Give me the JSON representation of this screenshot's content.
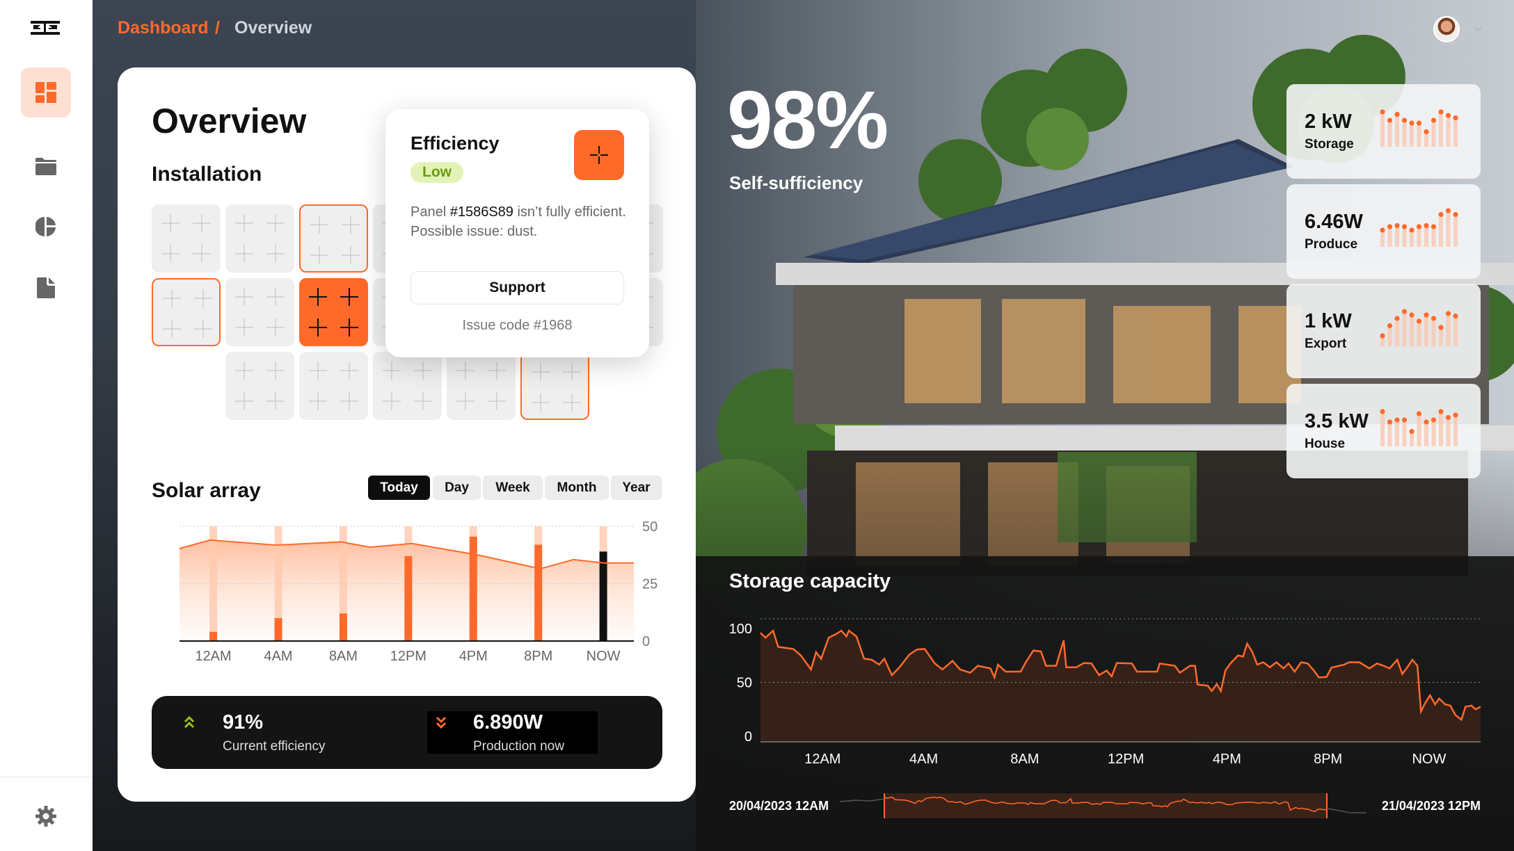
{
  "breadcrumb": {
    "root": "Dashboard",
    "separator": "/",
    "current": "Overview"
  },
  "sidebar": {
    "items": [
      {
        "name": "dashboard",
        "active": true
      },
      {
        "name": "folder"
      },
      {
        "name": "pie-chart"
      },
      {
        "name": "document"
      }
    ],
    "settings": "gear"
  },
  "overview": {
    "title": "Overview",
    "installation_title": "Installation",
    "tiles": [
      {
        "row": 0,
        "col": 0,
        "state": "normal"
      },
      {
        "row": 0,
        "col": 1,
        "state": "normal"
      },
      {
        "row": 0,
        "col": 2,
        "state": "outlined"
      },
      {
        "row": 0,
        "col": 3,
        "state": "normal"
      },
      {
        "row": 0,
        "col": 4,
        "state": "normal"
      },
      {
        "row": 0,
        "col": 5,
        "state": "normal"
      },
      {
        "row": 0,
        "col": 6,
        "state": "normal"
      },
      {
        "row": 1,
        "col": 0,
        "state": "outlined"
      },
      {
        "row": 1,
        "col": 1,
        "state": "normal"
      },
      {
        "row": 1,
        "col": 2,
        "state": "active"
      },
      {
        "row": 1,
        "col": 3,
        "state": "normal"
      },
      {
        "row": 1,
        "col": 4,
        "state": "normal"
      },
      {
        "row": 1,
        "col": 5,
        "state": "normal"
      },
      {
        "row": 1,
        "col": 6,
        "state": "normal"
      },
      {
        "row": 2,
        "col": 1,
        "state": "normal"
      },
      {
        "row": 2,
        "col": 2,
        "state": "normal"
      },
      {
        "row": 2,
        "col": 3,
        "state": "normal"
      },
      {
        "row": 2,
        "col": 4,
        "state": "normal"
      },
      {
        "row": 2,
        "col": 5,
        "state": "outlined"
      }
    ]
  },
  "popup": {
    "title": "Efficiency",
    "badge": "Low",
    "text_prefix": "Panel ",
    "panel_id": "#1586S89",
    "text_suffix": " isn’t fully efficient. Possible issue: dust.",
    "button": "Support",
    "issue_code": "Issue code #1968"
  },
  "solar": {
    "title": "Solar array",
    "tabs": [
      "Today",
      "Day",
      "Week",
      "Month",
      "Year"
    ],
    "active_tab": "Today"
  },
  "stats": {
    "efficiency_value": "91%",
    "efficiency_label": "Current efficiency",
    "production_value": "6.890W",
    "production_label": "Production now"
  },
  "hero": {
    "value": "98%",
    "label": "Self-sufficiency"
  },
  "metrics": [
    {
      "value": "2 kW",
      "label": "Storage",
      "spark": [
        10,
        7.6,
        9.3,
        7.6,
        6.8,
        6.8,
        4.3,
        7.6,
        10,
        9,
        8.3
      ]
    },
    {
      "value": "6.46W",
      "label": "Produce",
      "spark": [
        4.8,
        5.8,
        6.1,
        5.8,
        4.8,
        5.8,
        6.1,
        5.8,
        9.3,
        10.4,
        9.3
      ]
    },
    {
      "value": "1 kW",
      "label": "Export",
      "spark": [
        3,
        5.9,
        8,
        10,
        9,
        7.2,
        9,
        8,
        5.4,
        9.4,
        8.7
      ]
    },
    {
      "value": "3.5 kW",
      "label": "House",
      "spark": [
        10,
        7,
        7.6,
        7.6,
        4.3,
        9.4,
        7,
        7.6,
        10,
        8.3,
        9
      ]
    }
  ],
  "storage": {
    "title": "Storage capacity",
    "range_start": "20/04/2023 12AM",
    "range_end": "21/04/2023 12PM"
  },
  "colors": {
    "accent": "#ff6a2b",
    "accent_light": "#fde0d2",
    "badge_bg": "#e3f3b8",
    "badge_text": "#6d9a12",
    "dark": "#141414"
  },
  "chart_data": [
    {
      "type": "bar",
      "categories": [
        "12AM",
        "4AM",
        "8AM",
        "12PM",
        "4PM",
        "8PM",
        "NOW"
      ],
      "series": [
        {
          "values": [
            4,
            10,
            12,
            37,
            45.5,
            42,
            39
          ]
        },
        {
          "values": [
            50,
            50,
            50,
            50,
            50,
            50,
            50
          ]
        }
      ],
      "highlight": "NOW",
      "line": {
        "x": [
          -0.52,
          -0.05,
          0.98,
          1.97,
          2.41,
          3.06,
          4.07,
          5.03,
          5.54,
          6.01,
          6.47
        ],
        "y": [
          40.3,
          44,
          41.8,
          43.2,
          40.9,
          42.5,
          37.5,
          31.5,
          35.5,
          34,
          34
        ]
      },
      "yticks": [
        0,
        25,
        50
      ],
      "ylim": [
        0,
        50
      ],
      "grid": true
    },
    {
      "type": "area",
      "xticks": [
        "12AM",
        "4AM",
        "8AM",
        "12PM",
        "4PM",
        "8PM",
        "NOW"
      ],
      "xtick_hours": [
        0,
        4,
        8,
        12,
        16,
        20,
        24
      ],
      "yticks": [
        0,
        50,
        100
      ],
      "ylim": [
        0,
        109
      ],
      "grid": true,
      "x_hours": [
        -2.46,
        -2.26,
        -1.96,
        -1.76,
        -1.16,
        -0.86,
        -0.46,
        -0.26,
        -0.06,
        0.24,
        0.54,
        0.74,
        0.94,
        1.04,
        1.34,
        1.64,
        1.94,
        2.24,
        2.44,
        2.74,
        3.04,
        3.44,
        3.74,
        4.04,
        4.44,
        4.74,
        5.14,
        5.44,
        5.84,
        6.14,
        6.64,
        6.8,
        6.94,
        7.24,
        7.84,
        8.04,
        8.34,
        8.64,
        8.84,
        9.24,
        9.54,
        9.64,
        10.04,
        10.34,
        10.64,
        10.94,
        11.24,
        11.44,
        11.64,
        12.24,
        12.44,
        13.24,
        13.34,
        13.94,
        14.14,
        14.54,
        14.74,
        14.84,
        15.24,
        15.4,
        15.6,
        15.76,
        15.94,
        16.14,
        16.44,
        16.64,
        16.8,
        17,
        17.2,
        17.44,
        17.7,
        17.96,
        18.24,
        18.44,
        18.68,
        18.94,
        19.2,
        19.44,
        19.64,
        19.94,
        20.14,
        20.64,
        20.84,
        21.24,
        21.64,
        21.94,
        22.2,
        22.44,
        22.74,
        22.94,
        23.14,
        23.34,
        23.54,
        23.68,
        23.84,
        24.04,
        24.24,
        24.4,
        24.64,
        24.84,
        25.04,
        25.28,
        25.44,
        25.68,
        25.84,
        26.04
      ],
      "values": [
        96,
        91.5,
        98,
        83,
        81,
        75,
        62,
        78,
        72,
        91.5,
        95,
        98,
        92.6,
        98,
        92.6,
        72,
        71,
        66.5,
        72,
        56.7,
        64,
        76,
        80.6,
        81,
        67.6,
        62,
        70,
        62,
        59,
        65.4,
        63,
        54.6,
        66.5,
        60,
        60,
        68.7,
        79.6,
        78.7,
        65.4,
        65.4,
        89,
        64,
        64,
        68,
        67.6,
        56.7,
        61,
        55.6,
        68,
        67.6,
        60,
        60,
        67.6,
        65.4,
        59,
        65.4,
        65.4,
        48,
        47,
        42,
        48.5,
        42,
        61,
        67.6,
        75,
        74,
        86,
        78.5,
        66.5,
        68.7,
        64,
        68.7,
        63,
        67.6,
        60,
        68.7,
        67.6,
        61,
        54.6,
        55,
        63.7,
        66.5,
        68.7,
        68.7,
        63,
        67.6,
        65.4,
        63,
        71,
        57.8,
        64,
        71,
        65.4,
        23,
        30.6,
        38,
        29.6,
        35,
        29.6,
        28.5,
        19.8,
        15.4,
        27.4,
        28.5,
        25,
        27.4
      ]
    }
  ]
}
